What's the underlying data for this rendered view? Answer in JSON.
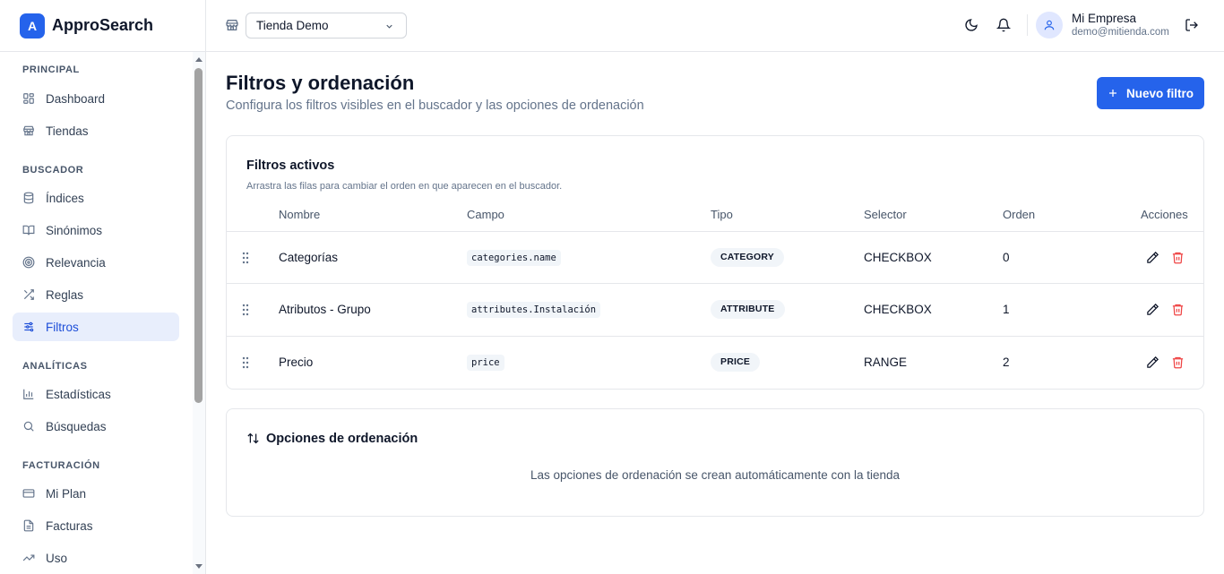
{
  "brand": {
    "logo_letter": "A",
    "name": "ApproSearch",
    "color": "#2563eb"
  },
  "sidebar": {
    "sections": [
      {
        "label": "PRINCIPAL",
        "items": [
          {
            "label": "Dashboard",
            "icon": "dashboard-icon"
          },
          {
            "label": "Tiendas",
            "icon": "store-icon"
          }
        ]
      },
      {
        "label": "BUSCADOR",
        "items": [
          {
            "label": "Índices",
            "icon": "database-icon"
          },
          {
            "label": "Sinónimos",
            "icon": "book-icon"
          },
          {
            "label": "Relevancia",
            "icon": "target-icon"
          },
          {
            "label": "Reglas",
            "icon": "shuffle-icon"
          },
          {
            "label": "Filtros",
            "icon": "sliders-icon",
            "active": true
          }
        ]
      },
      {
        "label": "ANALÍTICAS",
        "items": [
          {
            "label": "Estadísticas",
            "icon": "bar-chart-icon"
          },
          {
            "label": "Búsquedas",
            "icon": "search-icon"
          }
        ]
      },
      {
        "label": "FACTURACIÓN",
        "items": [
          {
            "label": "Mi Plan",
            "icon": "credit-card-icon"
          },
          {
            "label": "Facturas",
            "icon": "file-text-icon"
          },
          {
            "label": "Uso",
            "icon": "trending-up-icon"
          }
        ]
      }
    ]
  },
  "topbar": {
    "store_selected": "Tienda Demo",
    "user_name": "Mi Empresa",
    "user_email": "demo@mitienda.com"
  },
  "main": {
    "title": "Filtros y ordenación",
    "subtitle": "Configura los filtros visibles en el buscador y las opciones de ordenación",
    "new_filter_label": "Nuevo filtro",
    "filters_card": {
      "title": "Filtros activos",
      "subtitle": "Arrastra las filas para cambiar el orden en que aparecen en el buscador.",
      "columns": [
        "Nombre",
        "Campo",
        "Tipo",
        "Selector",
        "Orden",
        "Acciones"
      ],
      "rows": [
        {
          "name": "Categorías",
          "field": "categories.name",
          "type": "CATEGORY",
          "selector": "CHECKBOX",
          "order": "0"
        },
        {
          "name": "Atributos - Grupo",
          "field": "attributes.Instalación",
          "type": "ATTRIBUTE",
          "selector": "CHECKBOX",
          "order": "1"
        },
        {
          "name": "Precio",
          "field": "price",
          "type": "PRICE",
          "selector": "RANGE",
          "order": "2"
        }
      ]
    },
    "sort_card": {
      "title": "Opciones de ordenación",
      "message": "Las opciones de ordenación se crean automáticamente con la tienda"
    }
  }
}
